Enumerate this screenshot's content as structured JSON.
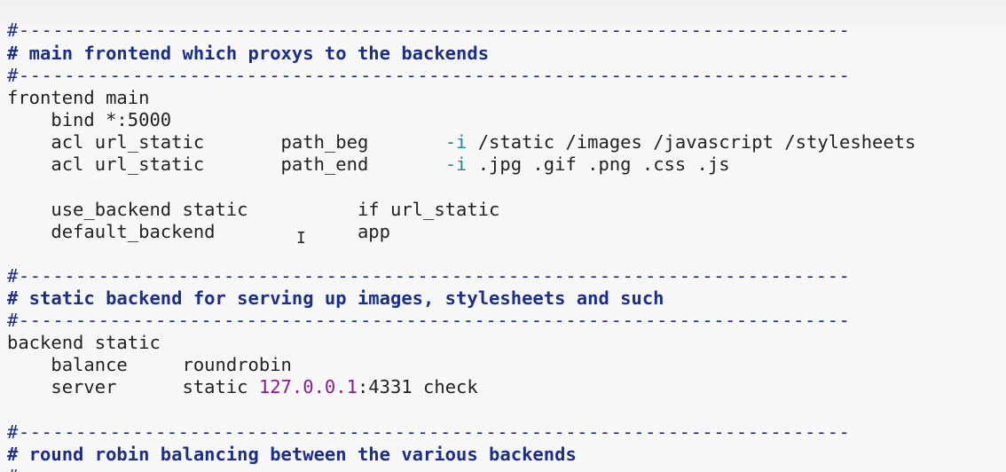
{
  "editor": {
    "lines": {
      "l1": "#-------------------------------------------------------------------------",
      "l2": "# main frontend which proxys to the backends",
      "l3": "#-------------------------------------------------------------------------",
      "l4": "frontend main",
      "l5": "    bind *:5000",
      "l6a": "    acl url_static       path_beg       ",
      "l6flag": "-i",
      "l6b": " /static /images /javascript /stylesheets",
      "l7a": "    acl url_static       path_end       ",
      "l7flag": "-i",
      "l7b": " .jpg .gif .png .css .js",
      "l9": "    use_backend static          if url_static",
      "l10": "    default_backend             app",
      "l12": "#-------------------------------------------------------------------------",
      "l13": "# static backend for serving up images, stylesheets and such",
      "l14": "#-------------------------------------------------------------------------",
      "l15": "backend static",
      "l16": "    balance     roundrobin",
      "l17a": "    server      static ",
      "l17num": "127.0.0.1",
      "l17b": ":4331 check",
      "l19": "#-------------------------------------------------------------------------",
      "l20": "# round robin balancing between the various backends",
      "l21": "#"
    },
    "cursor_glyph": "I",
    "colors": {
      "comment": "#1c2f86",
      "flag": "#1f8a8a",
      "number": "#8a1f8a",
      "text": "#222222"
    }
  }
}
